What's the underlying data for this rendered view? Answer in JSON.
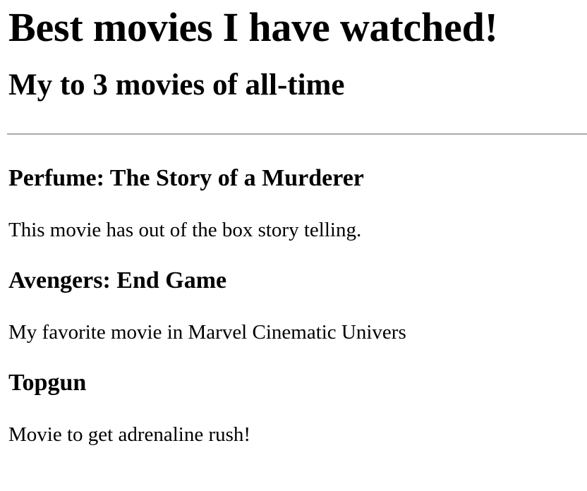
{
  "page": {
    "heading": "Best movies I have watched!",
    "subheading": "My to 3 movies of all-time"
  },
  "movies": [
    {
      "title": "Perfume: The Story of a Murderer",
      "description": "This movie has out of the box story telling."
    },
    {
      "title": "Avengers: End Game",
      "description": "My favorite movie in Marvel Cinematic Univers"
    },
    {
      "title": "Topgun",
      "description": "Movie to get adrenaline rush!"
    }
  ],
  "colors": {
    "text": "#000000",
    "background": "#ffffff",
    "divider": "#a9a9a9"
  }
}
